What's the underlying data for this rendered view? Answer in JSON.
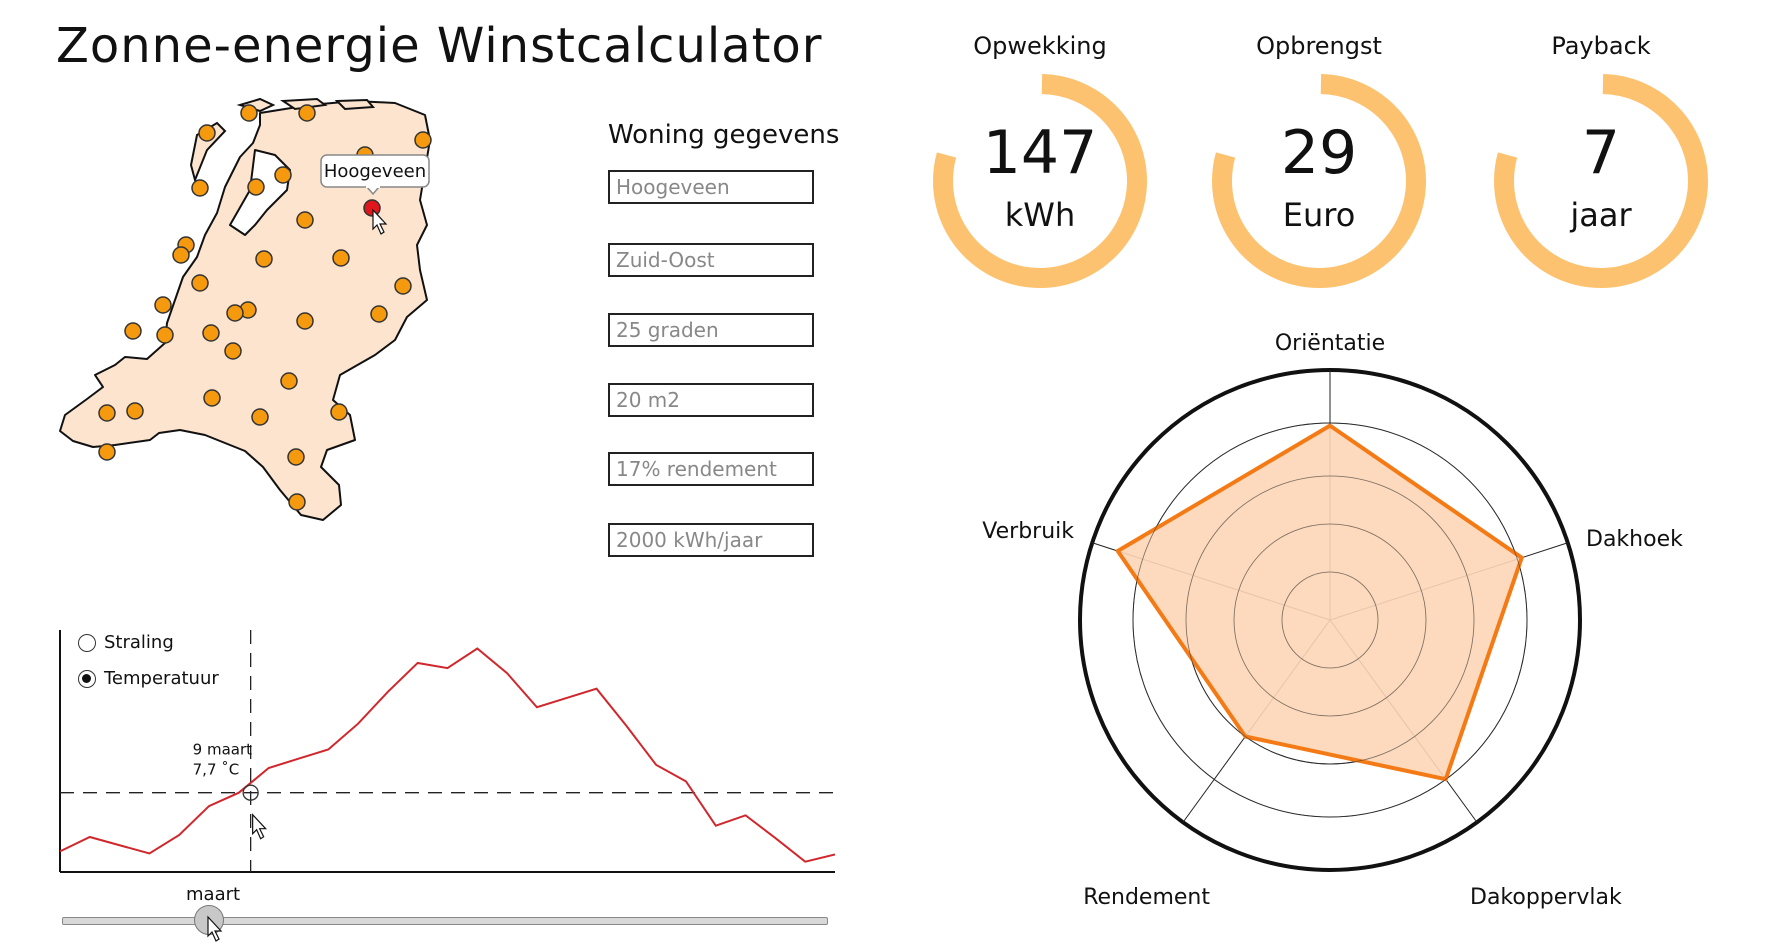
{
  "app": {
    "title": "Zonne-energie Winstcalculator"
  },
  "map": {
    "tooltip": "Hoogeveen",
    "colors": {
      "land": "#fce4cf",
      "dot": "#f59a0e",
      "selected": "#e0161c"
    }
  },
  "form": {
    "title": "Woning gegevens",
    "fields": [
      {
        "placeholder": "Hoogeveen"
      },
      {
        "placeholder": "Zuid-Oost"
      },
      {
        "placeholder": "25 graden"
      },
      {
        "placeholder": "20 m2"
      },
      {
        "placeholder": "17% rendement"
      },
      {
        "placeholder": "2000 kWh/jaar"
      }
    ]
  },
  "chart_data": {
    "type": "line",
    "options": [
      "Straling",
      "Temperatuur"
    ],
    "selected": "Temperatuur",
    "tooltip": {
      "date": "9 maart",
      "value": "7,7 ˚C"
    },
    "cursor_index": 7,
    "y": [
      2.0,
      3.4,
      2.6,
      1.8,
      3.6,
      6.4,
      7.7,
      10.1,
      11.0,
      11.9,
      14.4,
      17.5,
      20.3,
      19.8,
      21.7,
      19.3,
      16.0,
      16.9,
      17.8,
      14.2,
      10.4,
      8.8,
      4.5,
      5.5,
      3.3,
      1.0,
      1.7
    ],
    "x_index": [
      0,
      1,
      2,
      3,
      4,
      5,
      6,
      7,
      8,
      9,
      10,
      11,
      12,
      13,
      14,
      15,
      16,
      17,
      18,
      19,
      20,
      21,
      22,
      23,
      24,
      25,
      26
    ],
    "reference_y": 7.7,
    "line_color": "#d0272c"
  },
  "slider": {
    "label": "maart"
  },
  "kpis": [
    {
      "label": "Opwekking",
      "value": "147",
      "unit": "kWh",
      "fraction": 0.79
    },
    {
      "label": "Opbrengst",
      "value": "29",
      "unit": "Euro",
      "fraction": 0.79
    },
    {
      "label": "Payback",
      "value": "7",
      "unit": "jaar",
      "fraction": 0.79
    }
  ],
  "radar": {
    "axes": [
      "Oriëntatie",
      "Dakhoek",
      "Dakoppervlak",
      "Rendement",
      "Verbruik"
    ],
    "values": [
      0.81,
      0.84,
      0.82,
      0.6,
      0.93
    ],
    "colors": {
      "stroke": "#f47a15",
      "fill": "#fdd6b6",
      "ring": "#fcc26f"
    }
  }
}
